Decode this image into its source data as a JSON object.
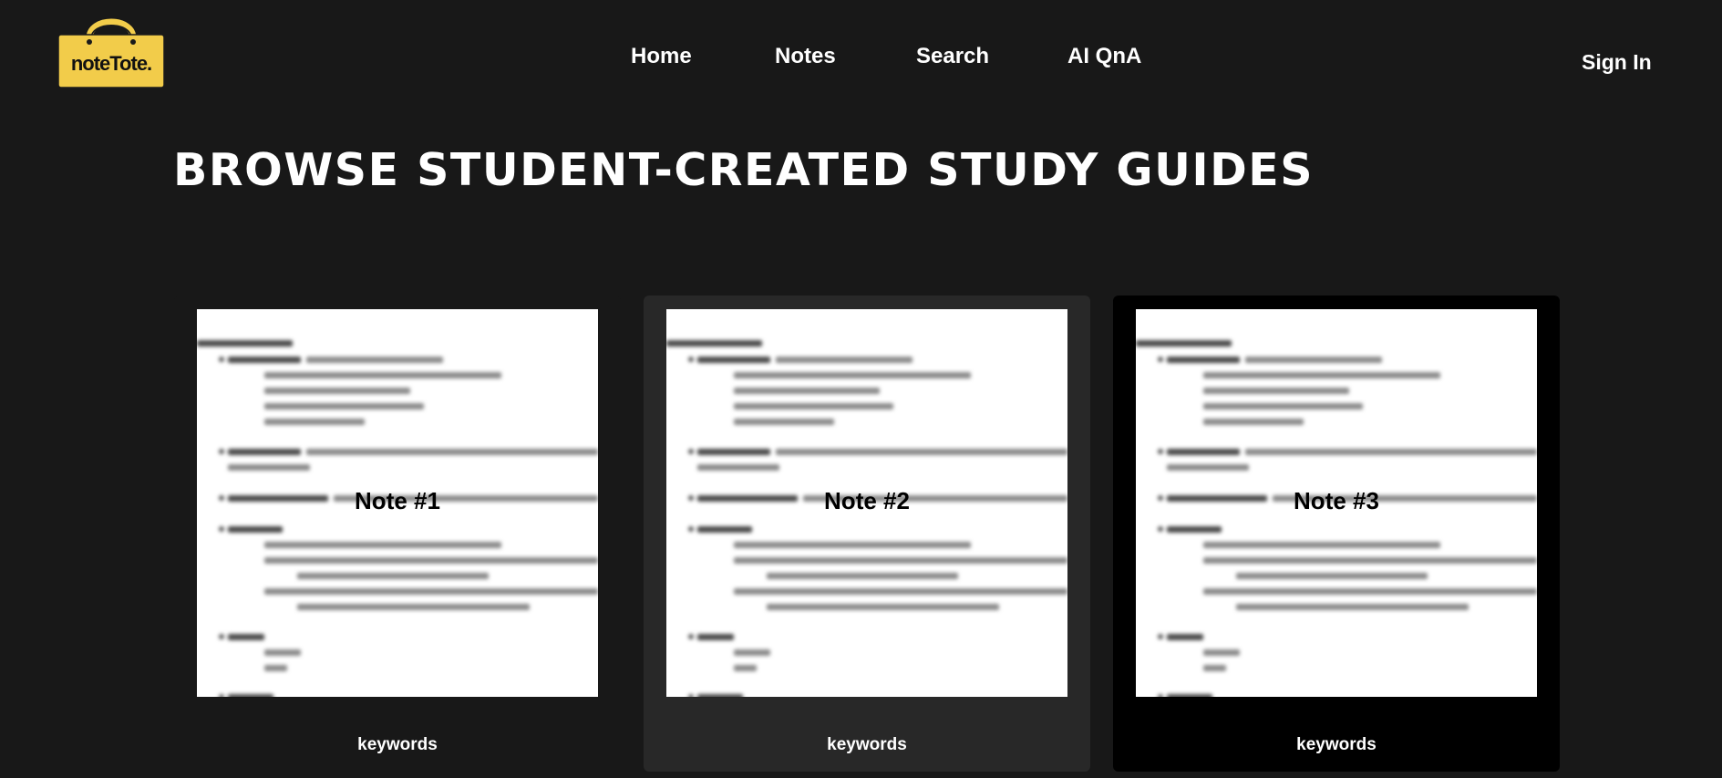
{
  "brand": {
    "logo_text": "noteTote.",
    "logo_color": "#f2cc4a"
  },
  "nav": {
    "items": [
      {
        "label": "Home"
      },
      {
        "label": "Notes"
      },
      {
        "label": "Search"
      },
      {
        "label": "AI QnA"
      }
    ],
    "sign_in": "Sign In"
  },
  "page": {
    "title": "BROWSE STUDENT-CREATED STUDY GUIDES"
  },
  "cards": [
    {
      "title": "Note #1",
      "keywords": "keywords",
      "background": "#181818"
    },
    {
      "title": "Note #2",
      "keywords": "keywords",
      "background": "#282828"
    },
    {
      "title": "Note #3",
      "keywords": "keywords",
      "background": "#000000"
    }
  ]
}
